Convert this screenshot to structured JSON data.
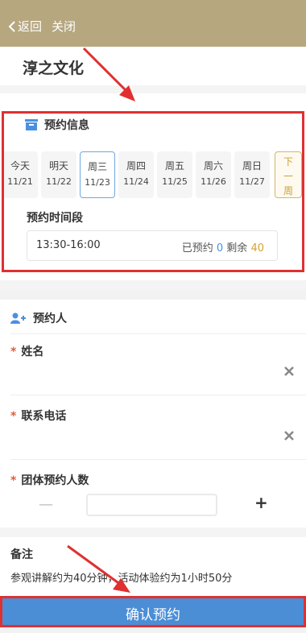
{
  "header": {
    "back_label": "返回",
    "close_label": "关闭"
  },
  "page": {
    "title": "淳之文化"
  },
  "booking": {
    "section_title": "预约信息",
    "days": [
      {
        "weekday": "今天",
        "date": "11/21"
      },
      {
        "weekday": "明天",
        "date": "11/22"
      },
      {
        "weekday": "周三",
        "date": "11/23"
      },
      {
        "weekday": "周四",
        "date": "11/24"
      },
      {
        "weekday": "周五",
        "date": "11/25"
      },
      {
        "weekday": "周六",
        "date": "11/26"
      },
      {
        "weekday": "周日",
        "date": "11/27"
      }
    ],
    "selected_day": 2,
    "next_week_label": "下一周",
    "time_section_title": "预约时间段",
    "slot": {
      "time": "13:30-16:00",
      "booked_label": "已预约",
      "booked_count": "0",
      "remaining_label": "剩余",
      "remaining_count": "40"
    }
  },
  "person": {
    "section_title": "预约人",
    "name_label": "姓名",
    "phone_label": "联系电话",
    "group_label": "团体预约人数",
    "minus_label": "—",
    "plus_label": "+"
  },
  "note": {
    "title": "备注",
    "text": "参观讲解约为40分钟，活动体验约为1小时50分"
  },
  "footer": {
    "confirm_label": "确认预约"
  },
  "colors": {
    "header": "#b6a77f",
    "accent_blue": "#4b8ed6",
    "gold": "#d4a52f",
    "annotation_red": "#e03030"
  }
}
